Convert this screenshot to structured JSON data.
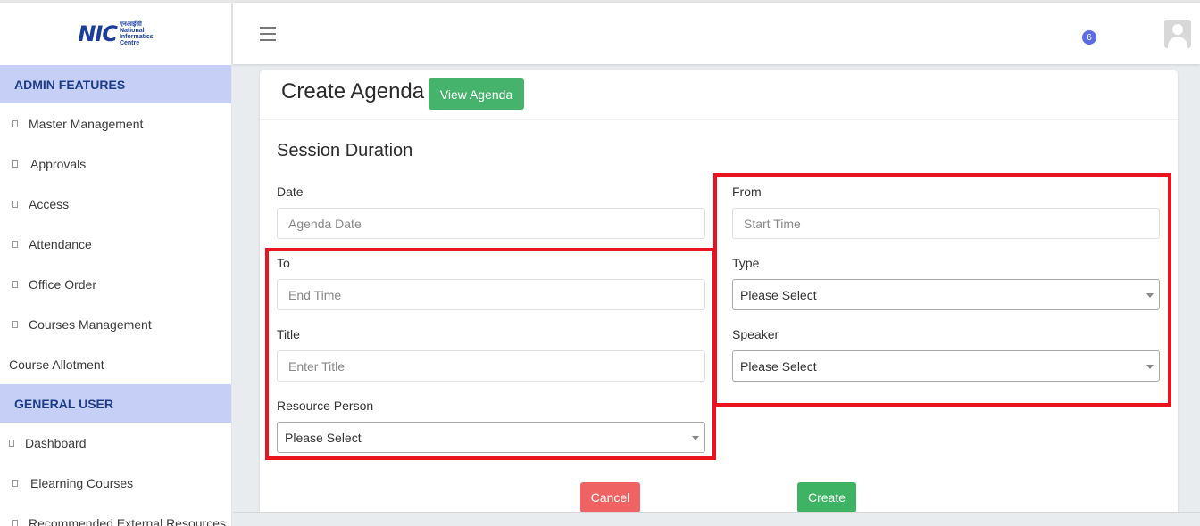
{
  "logo": {
    "abbr": "NIC",
    "hindi": "एनआईसी",
    "line1": "National",
    "line2": "Informatics",
    "line3": "Centre"
  },
  "sidebar": {
    "admin_heading": "ADMIN FEATURES",
    "admin_items": [
      {
        "label": "Master Management"
      },
      {
        "label": "Approvals"
      },
      {
        "label": "Access"
      },
      {
        "label": "Attendance"
      },
      {
        "label": "Office Order"
      },
      {
        "label": "Courses Management"
      }
    ],
    "course_allotment": "Course Allotment",
    "general_heading": "GENERAL USER",
    "general_items": [
      {
        "label": "Dashboard"
      },
      {
        "label": "Elearning Courses"
      },
      {
        "label": "Recommended External Resources"
      }
    ]
  },
  "header": {
    "notification_count": "6"
  },
  "page": {
    "title": "Create Agenda",
    "view_button": "View Agenda",
    "section_title": "Session Duration"
  },
  "form": {
    "date_label": "Date",
    "date_placeholder": "Agenda Date",
    "from_label": "From",
    "from_placeholder": "Start Time",
    "to_label": "To",
    "to_placeholder": "End Time",
    "type_label": "Type",
    "type_value": "Please Select",
    "title_label": "Title",
    "title_placeholder": "Enter Title",
    "speaker_label": "Speaker",
    "speaker_value": "Please Select",
    "resource_label": "Resource Person",
    "resource_value": "Please Select"
  },
  "actions": {
    "cancel": "Cancel",
    "create": "Create"
  },
  "colors": {
    "highlight_box": "#e8141f",
    "sidebar_heading_bg": "#c6d0f7",
    "primary_green": "#45b36b",
    "cancel_red": "#f06363"
  }
}
